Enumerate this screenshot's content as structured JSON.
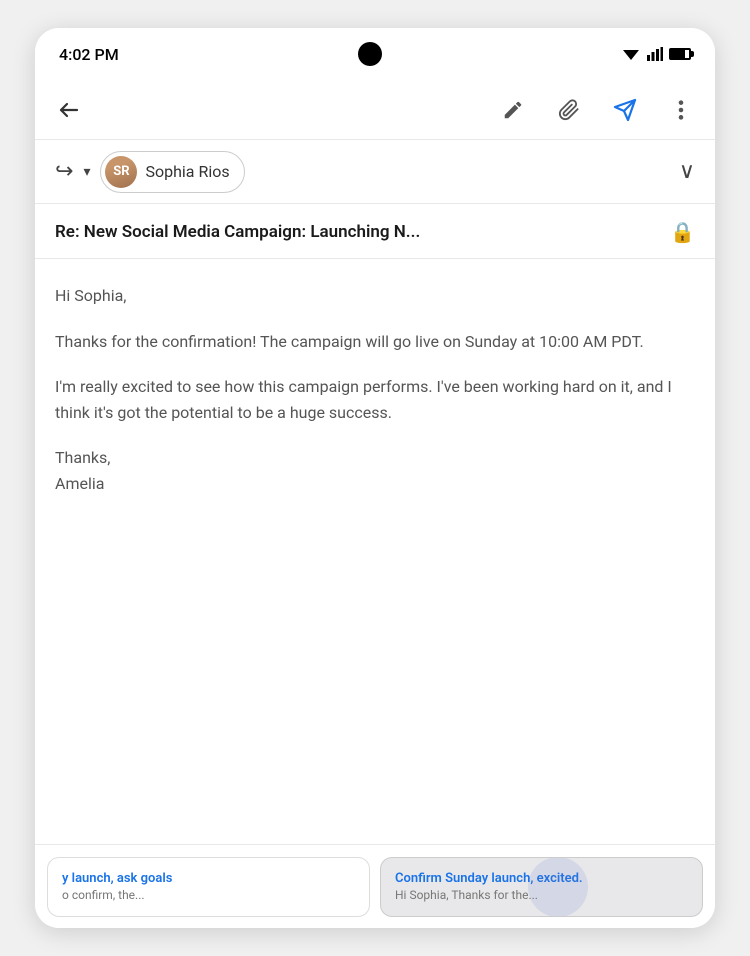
{
  "statusBar": {
    "time": "4:02 PM"
  },
  "toolbar": {
    "backLabel": "←",
    "pencilLabel": "✏",
    "attachLabel": "⊙",
    "sendLabel": "▷",
    "moreLabel": "⋮"
  },
  "recipientRow": {
    "replySymbol": "↩",
    "dropdownSymbol": "▾",
    "recipientName": "Sophia Rios",
    "avatarInitials": "SR",
    "chevronDown": "∨"
  },
  "subject": {
    "text": "Re: New Social Media Campaign: Launching N...",
    "lockIcon": "🔒"
  },
  "emailBody": {
    "greeting": "Hi Sophia,",
    "paragraph1": "Thanks for the confirmation! The campaign will go live on Sunday at 10:00 AM PDT.",
    "paragraph2": "I'm really excited to see how this campaign performs. I've been working hard on it, and I think it's got the potential to be a huge success.",
    "closing": "Thanks,",
    "signature": "Amelia"
  },
  "smartReplies": [
    {
      "id": "chip1",
      "title": "y launch, ask goals",
      "preview": "o confirm, the...",
      "selected": false
    },
    {
      "id": "chip2",
      "title": "Confirm Sunday launch, excited.",
      "preview": "Hi Sophia, Thanks for the...",
      "selected": true
    }
  ]
}
